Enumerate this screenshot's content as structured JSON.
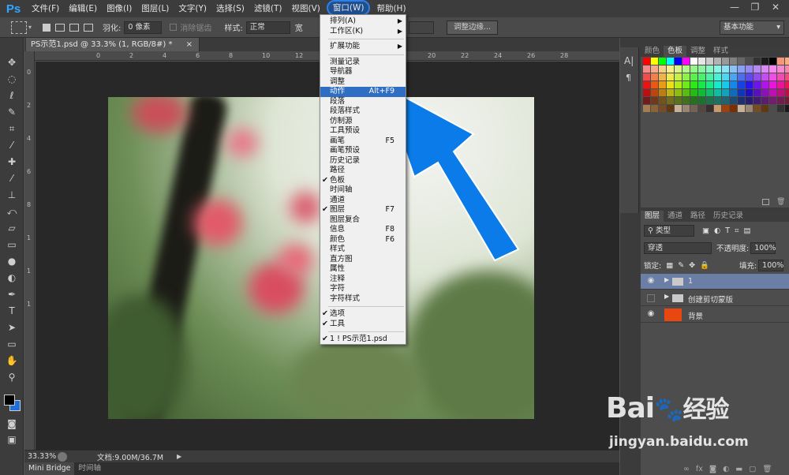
{
  "app": {
    "logo": "Ps"
  },
  "menubar": {
    "items": [
      "文件(F)",
      "编辑(E)",
      "图像(I)",
      "图层(L)",
      "文字(Y)",
      "选择(S)",
      "滤镜(T)",
      "视图(V)",
      "窗口(W)",
      "帮助(H)"
    ],
    "active": "窗口(W)"
  },
  "window_controls": {
    "minimize": "—",
    "restore": "❐",
    "close": "✕"
  },
  "options": {
    "feather_label": "羽化:",
    "feather_value": "0 像素",
    "antialias_label": "消除锯齿",
    "style_label": "样式:",
    "style_value": "正常",
    "width_label": "宽",
    "refine_edge_button": "调整边缘...",
    "workspace": "基本功能"
  },
  "document": {
    "tab_title": "PS示范1.psd @ 33.3% (1, RGB/8#) *",
    "tab_close": "×",
    "zoom": "33.33%",
    "doc_info": "文档:9.00M/36.7M"
  },
  "rulers": {
    "top": [
      "0",
      "2",
      "4",
      "6",
      "8",
      "10",
      "12",
      "14",
      "16",
      "18",
      "20",
      "22",
      "24",
      "26",
      "28"
    ],
    "left": [
      "0",
      "2",
      "4",
      "6",
      "8",
      "1",
      "1",
      "1"
    ]
  },
  "bottom_tabs": [
    "Mini Bridge",
    "时间轴"
  ],
  "window_menu": {
    "items": [
      {
        "label": "排列(A)",
        "arrow": true
      },
      {
        "label": "工作区(K)",
        "arrow": true
      },
      {
        "sep": true
      },
      {
        "label": "扩展功能",
        "arrow": true
      },
      {
        "sep": true
      },
      {
        "label": "测量记录"
      },
      {
        "label": "导航器"
      },
      {
        "label": "调整"
      },
      {
        "label": "动作",
        "shortcut": "Alt+F9",
        "highlight": true
      },
      {
        "label": "段落"
      },
      {
        "label": "段落样式"
      },
      {
        "label": "仿制源"
      },
      {
        "label": "工具预设"
      },
      {
        "label": "画笔",
        "shortcut": "F5"
      },
      {
        "label": "画笔预设"
      },
      {
        "label": "历史记录"
      },
      {
        "label": "路径"
      },
      {
        "label": "色板",
        "checked": true
      },
      {
        "label": "时间轴"
      },
      {
        "label": "通道"
      },
      {
        "label": "图层",
        "shortcut": "F7",
        "checked": true
      },
      {
        "label": "图层复合"
      },
      {
        "label": "信息",
        "shortcut": "F8"
      },
      {
        "label": "颜色",
        "shortcut": "F6"
      },
      {
        "label": "样式"
      },
      {
        "label": "直方图"
      },
      {
        "label": "属性"
      },
      {
        "label": "注释"
      },
      {
        "label": "字符"
      },
      {
        "label": "字符样式"
      },
      {
        "sep": true
      },
      {
        "label": "选项",
        "checked": true
      },
      {
        "label": "工具",
        "checked": true
      },
      {
        "sep": true
      },
      {
        "label": "1 ! PS示范1.psd",
        "checked": true
      }
    ]
  },
  "swatch_panel": {
    "tabs": [
      "颜色",
      "色板",
      "调整",
      "样式"
    ],
    "active_tab": "色板"
  },
  "layers_panel": {
    "tabs": [
      "图层",
      "通道",
      "路径",
      "历史记录"
    ],
    "active_tab": "图层",
    "filter_kind": "类型",
    "blend_mode": "穿透",
    "opacity_label": "不透明度:",
    "opacity_value": "100%",
    "lock_label": "锁定:",
    "fill_label": "填充:",
    "fill_value": "100%",
    "layers": [
      {
        "name": "1",
        "type": "group",
        "visible": true,
        "selected": true
      },
      {
        "name": "创建剪切蒙版",
        "type": "group",
        "visible": false,
        "selected": false
      },
      {
        "name": "背景",
        "type": "layer",
        "visible": true,
        "selected": false,
        "thumb_color": "#e8470f"
      }
    ]
  },
  "watermark": {
    "brand": "Bai",
    "brand_suffix": "经验",
    "url": "jingyan.baidu.com"
  },
  "colors": {
    "accent": "#2f6ec3",
    "arrow": "#0a7be8",
    "foreground": "#000000",
    "background": "#1e6fd9"
  }
}
